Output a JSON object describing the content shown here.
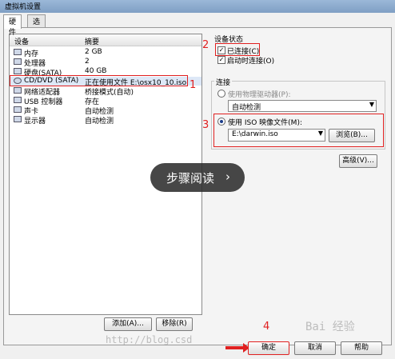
{
  "window": {
    "title": "虚拟机设置"
  },
  "tabs": [
    {
      "label": "硬件"
    },
    {
      "label": "选项"
    }
  ],
  "device_list": {
    "col_device": "设备",
    "col_summary": "摘要",
    "rows": [
      {
        "icon": "memory-icon",
        "name": "内存",
        "summary": "2 GB"
      },
      {
        "icon": "cpu-icon",
        "name": "处理器",
        "summary": "2"
      },
      {
        "icon": "harddisk-icon",
        "name": "硬盘(SATA)",
        "summary": "40 GB"
      },
      {
        "icon": "cd-dvd-icon",
        "name": "CD/DVD (SATA)",
        "summary": "正在使用文件 E:\\osx10_10.iso"
      },
      {
        "icon": "network-icon",
        "name": "网络适配器",
        "summary": "桥接模式(自动)"
      },
      {
        "icon": "usb-icon",
        "name": "USB 控制器",
        "summary": "存在"
      },
      {
        "icon": "sound-icon",
        "name": "声卡",
        "summary": "自动检测"
      },
      {
        "icon": "display-icon",
        "name": "显示器",
        "summary": "自动检测"
      }
    ],
    "selected_index": 3
  },
  "buttons": {
    "add": "添加(A)...",
    "remove": "移除(R)",
    "browse": "浏览(B)...",
    "advanced": "高级(V)...",
    "ok": "确定",
    "cancel": "取消",
    "help": "帮助"
  },
  "device_status": {
    "label": "设备状态",
    "connected": {
      "label": "已连接(C)",
      "checked": true
    },
    "connect_on_power": {
      "label": "启动时连接(O)",
      "checked": true
    }
  },
  "connection": {
    "label": "连接",
    "physical_drive": {
      "label": "使用物理驱动器(P):",
      "selected": false,
      "value": "自动检测"
    },
    "iso_image": {
      "label": "使用 ISO 映像文件(M):",
      "selected": true,
      "value": "E:\\darwin.iso"
    }
  },
  "annotations": {
    "n1": "1",
    "n2": "2",
    "n3": "3",
    "n4": "4",
    "color": "#e02020"
  },
  "overlay": {
    "text": "步骤阅读",
    "icon": "chevron-right-icon"
  },
  "watermarks": {
    "url": "http://blog.csd",
    "site": "Bai 经验"
  }
}
